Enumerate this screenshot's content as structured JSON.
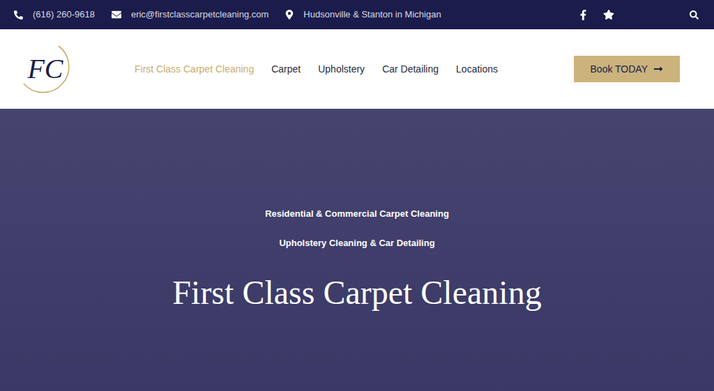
{
  "topbar": {
    "phone": "(616) 260-9618",
    "email": "eric@firstclasscarpetcleaning.com",
    "location": "Hudsonville & Stanton in Michigan"
  },
  "logo": {
    "text": "FC"
  },
  "nav": [
    {
      "label": "First Class Carpet Cleaning",
      "selected": true
    },
    {
      "label": "Carpet",
      "selected": false
    },
    {
      "label": "Upholstery",
      "selected": false
    },
    {
      "label": "Car Detailing",
      "selected": false
    },
    {
      "label": "Locations",
      "selected": false
    }
  ],
  "cta": {
    "label": "Book TODAY"
  },
  "hero": {
    "lines": [
      "Residential & Commercial Carpet Cleaning",
      "Upholstery Cleaning & Car Detailing"
    ],
    "title": "First Class Carpet Cleaning"
  }
}
